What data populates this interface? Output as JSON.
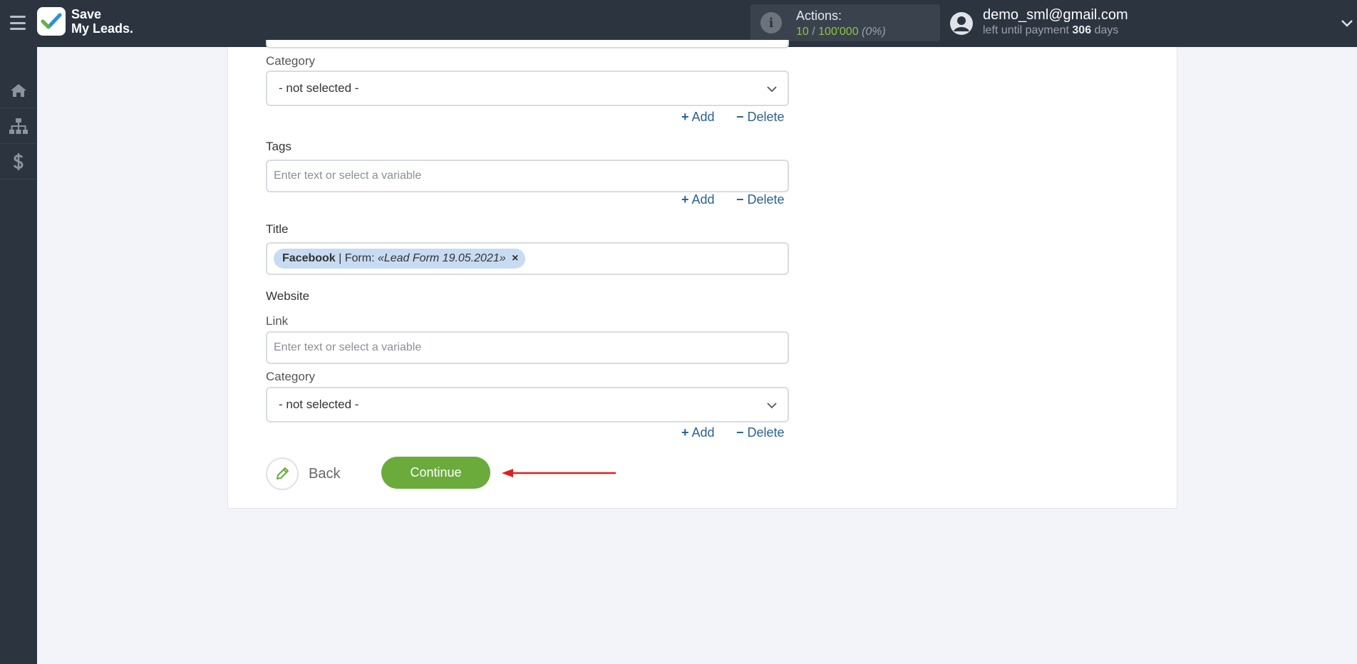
{
  "app": {
    "logo_line1": "Save",
    "logo_line2": "My Leads."
  },
  "actions": {
    "label": "Actions:",
    "used": "10",
    "separator": " / ",
    "limit": "100'000",
    "percent": "(0%)"
  },
  "user": {
    "email": "demo_sml@gmail.com",
    "payment_prefix": "left until payment ",
    "days": "306",
    "payment_suffix": " days"
  },
  "sidebar": {
    "items": [
      "home-icon",
      "sitemap-icon",
      "dollar-icon"
    ]
  },
  "form": {
    "category1": {
      "label": "Category",
      "value": "- not selected -"
    },
    "add_label": "Add",
    "delete_label": "Delete",
    "tags": {
      "label": "Tags",
      "placeholder": "Enter text or select a variable"
    },
    "title": {
      "label": "Title",
      "tag_source": "Facebook",
      "tag_sep": " | Form: ",
      "tag_form": "«Lead Form 19.05.2021»",
      "tag_remove": "×"
    },
    "website": {
      "label": "Website"
    },
    "link": {
      "label": "Link",
      "placeholder": "Enter text or select a variable"
    },
    "category2": {
      "label": "Category",
      "value": "- not selected -"
    }
  },
  "buttons": {
    "back": "Back",
    "continue": "Continue"
  },
  "colors": {
    "accent_green": "#6aab3c",
    "link_blue": "#2a6296",
    "arrow_red": "#e0201b",
    "topbar": "#2c3440"
  }
}
